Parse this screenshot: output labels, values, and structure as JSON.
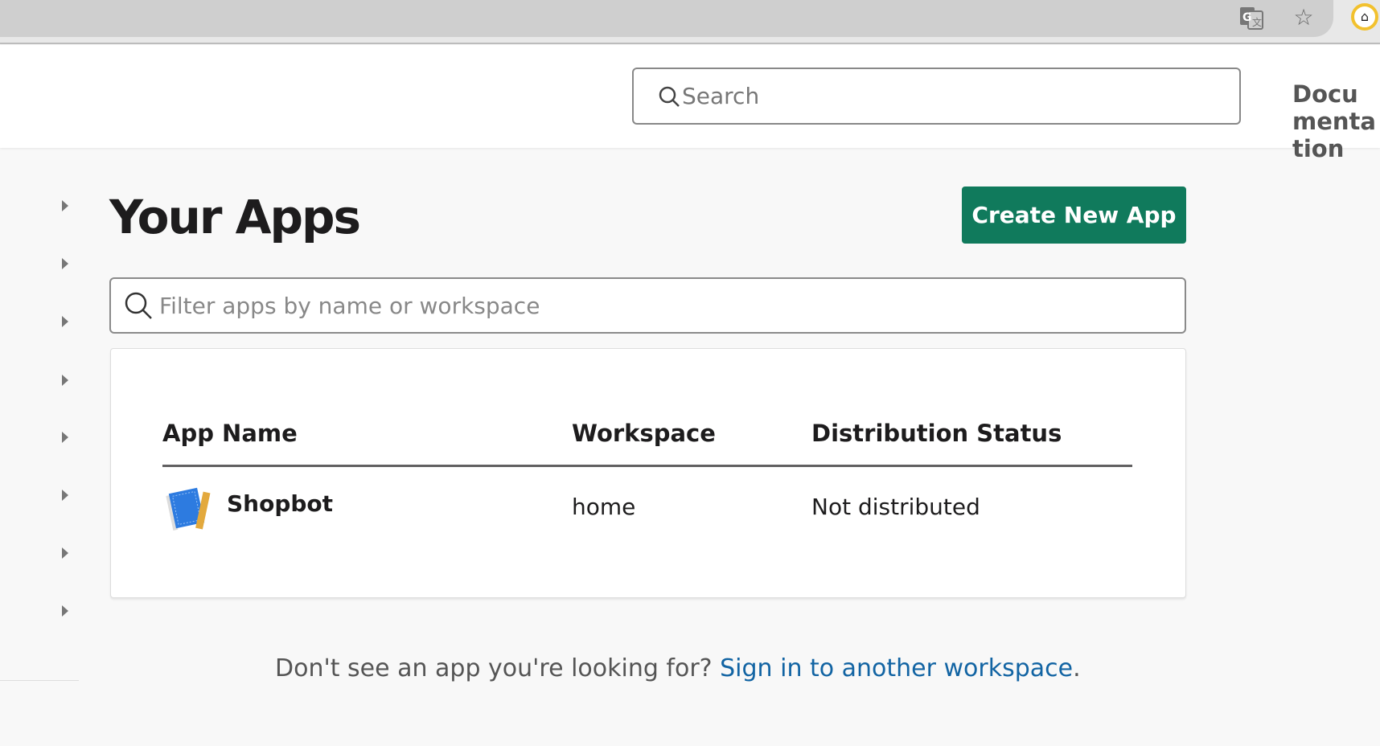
{
  "browser": {
    "icons": [
      "translate-icon",
      "bookmark-star-icon",
      "extension-home-icon"
    ]
  },
  "header": {
    "search_placeholder": "Search",
    "docs_link": "Documentation"
  },
  "main": {
    "title": "Your Apps",
    "create_button": "Create New App",
    "filter_placeholder": "Filter apps by name or workspace",
    "table": {
      "columns": [
        "App Name",
        "Workspace",
        "Distribution Status"
      ],
      "rows": [
        {
          "name": "Shopbot",
          "workspace": "home",
          "status": "Not distributed"
        }
      ]
    },
    "footer": {
      "text": "Don't see an app you're looking for?",
      "link": "Sign in to another workspace",
      "suffix": "."
    }
  },
  "colors": {
    "accent": "#107a5c",
    "link": "#1264a3"
  }
}
